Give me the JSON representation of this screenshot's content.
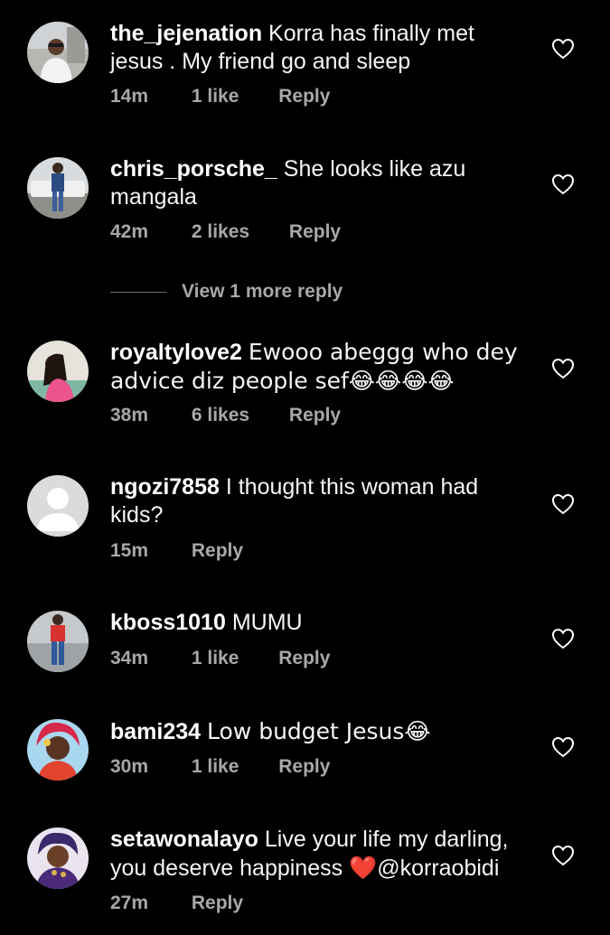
{
  "comments": [
    {
      "username": "the_jejenation",
      "text": "Korra has finally met jesus . My friend go and sleep",
      "time": "14m",
      "likes": "1 like",
      "reply": "Reply"
    },
    {
      "username": "chris_porsche_",
      "text": "She looks like azu mangala",
      "time": "42m",
      "likes": "2 likes",
      "reply": "Reply"
    },
    {
      "username": "royaltylove2",
      "text": "Ewooo abeggg who dey advice diz people sef😂😂😂😂",
      "time": "38m",
      "likes": "6 likes",
      "reply": "Reply"
    },
    {
      "username": "ngozi7858",
      "text": "I thought this woman had kids?",
      "time": "15m",
      "likes": "",
      "reply": "Reply"
    },
    {
      "username": "kboss1010",
      "text": "MUMU",
      "time": "34m",
      "likes": "1 like",
      "reply": "Reply"
    },
    {
      "username": "bami234",
      "text": "Low budget Jesus😂",
      "time": "30m",
      "likes": "1 like",
      "reply": "Reply"
    },
    {
      "username": "setawonalayo",
      "text_before": "Live your life my darling, you deserve happiness",
      "heart_emoji": "❤️",
      "text_after": "@korraobidi",
      "time": "27m",
      "likes": "",
      "reply": "Reply"
    }
  ],
  "view_more_replies": "View 1 more reply",
  "icons": {
    "like": "heart-outline-icon",
    "default_avatar": "default-avatar-icon"
  },
  "colors": {
    "background": "#000000",
    "text": "#ffffff",
    "meta": "#a8a8a8",
    "heart_emoji": "#e0243a"
  }
}
